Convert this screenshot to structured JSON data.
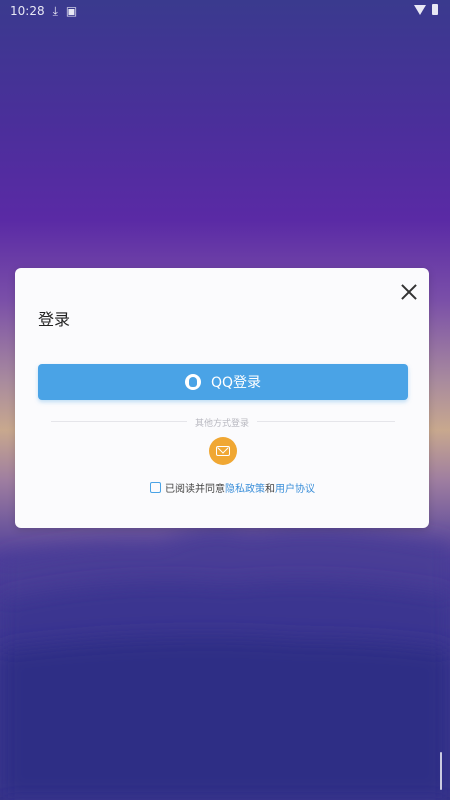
{
  "status_bar": {
    "time": "10:28",
    "icons": [
      "download-icon",
      "notification-icon",
      "wifi-icon",
      "battery-icon"
    ]
  },
  "dialog": {
    "title": "登录",
    "qq_login_label": "QQ登录",
    "other_methods_label": "其他方式登录",
    "agreement": {
      "prefix": "已阅读并同意",
      "privacy_link": "隐私政策",
      "connector": "和",
      "user_link": "用户协议"
    }
  },
  "colors": {
    "accent": "#4aa3e6",
    "mail_button": "#f0a733",
    "link": "#3b8fd9"
  }
}
